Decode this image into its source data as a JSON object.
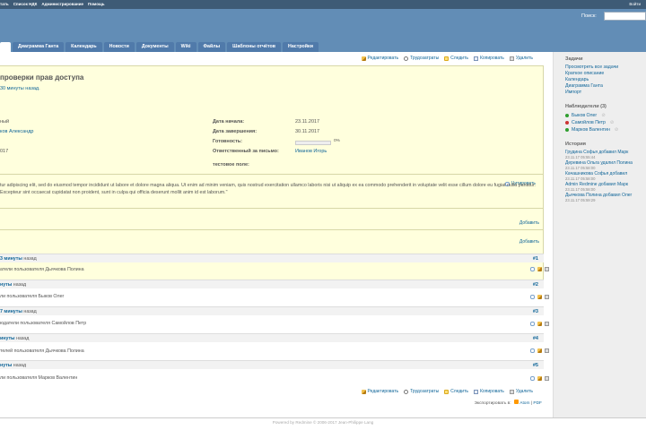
{
  "top_menu": {
    "items": [
      "тать",
      "Список НДК",
      "Администрирование",
      "Помощь"
    ],
    "right": "Войти"
  },
  "search": {
    "label": "Поиск:",
    "value": ""
  },
  "tabs": [
    "",
    "Диаграмма Ганта",
    "Календарь",
    "Новости",
    "Документы",
    "Wiki",
    "Файлы",
    "Шаблоны отчётов",
    "Настройки"
  ],
  "actions": {
    "edit": "Редактировать",
    "time": "Трудозатраты",
    "watch": "Следить",
    "copy": "Копировать",
    "delete": "Удалить"
  },
  "issue": {
    "subject": "проверки прав доступа",
    "author_line": "30 минуты назад.",
    "left_attrs": [
      "ный",
      "ков Александр",
      "",
      "017"
    ],
    "right_attrs": {
      "start_label": "Дата начала:",
      "start_value": "23.11.2017",
      "due_label": "Дата завершения:",
      "due_value": "30.11.2017",
      "done_label": "Готовность:",
      "done_value": "0%",
      "done_fraction": 0,
      "resp_label": "Ответственный за письмо:",
      "resp_value": "Иванов Игорь",
      "test_label": "тестовое поле:",
      "test_value": ""
    },
    "quote_label": "Цитировать",
    "description": "tur adipiscing elit, sed do eiusmod tempor incididunt ut labore et dolore magna aliqua. Ut enim ad minim veniam, quis nostrud exercitation ullamco laboris nisi ut aliquip ex ea commodo prehenderit in voluptate velit esse cillum dolore eu fugiat nulla pariatur. Excepteur sint occaecat cupidatat non proident, sunt in culpa qui officia deserunt mollit anim id est laborum.\"",
    "add_label": "Добавить"
  },
  "journals": [
    {
      "when_bold": "3 минуты",
      "when_rest": " назад",
      "num": "#1",
      "body": ""
    },
    {
      "when_bold": "нуты",
      "when_rest": " назад",
      "num": "#2",
      "body": "атели пользователя Дьячкова Полина"
    },
    {
      "when_bold": "7 минуты",
      "when_rest": " назад",
      "num": "#3",
      "body": "ли пользователя Быков Олег"
    },
    {
      "when_bold": "инуты",
      "when_rest": " назад",
      "num": "#4",
      "body": "юдатели пользователя Самойлов Петр"
    },
    {
      "when_bold": "нуты",
      "when_rest": " назад",
      "num": "#5",
      "body": "телей пользователя Дьячкова Полина"
    },
    {
      "when_bold": "",
      "when_rest": "",
      "num": "",
      "body": "ли пользователя Марков Валентин"
    }
  ],
  "export": {
    "label": "Экспортировать в:",
    "atom": "Atom",
    "pdf": "PDF"
  },
  "sidebar": {
    "tasks_title": "Задачи",
    "tasks_links": [
      "Просмотреть все задачи",
      "Краткое описание",
      "Календарь",
      "Диаграмма Ганта",
      "Импорт"
    ],
    "watchers_title": "Наблюдатели (3)",
    "watchers": [
      {
        "name": "Быков Олег",
        "color": "#2e9e2e"
      },
      {
        "name": "Самойлов Петр",
        "color": "#cc3333"
      },
      {
        "name": "Марков Валентин",
        "color": "#2e9e2e"
      }
    ],
    "history_title": "История",
    "history": [
      {
        "text": "Грудина Софья добавил Марк",
        "date": "23.11.17 05:55:44"
      },
      {
        "text": "Деревина Ольга удалил Полина",
        "date": "23.11.17 05:58:00"
      },
      {
        "text": "Качашникова Софья добавил",
        "date": "23.11.17 05:58:00"
      },
      {
        "text": "Admin Redmine добавил Марк",
        "date": "23.11.17 05:58:00"
      },
      {
        "text": "Дьячкова Полина добавил Олег",
        "date": "23.11.17 05:59:29"
      }
    ]
  },
  "footer": "Powered by Redmine © 2006-2017 Jean-Philippe Lang"
}
